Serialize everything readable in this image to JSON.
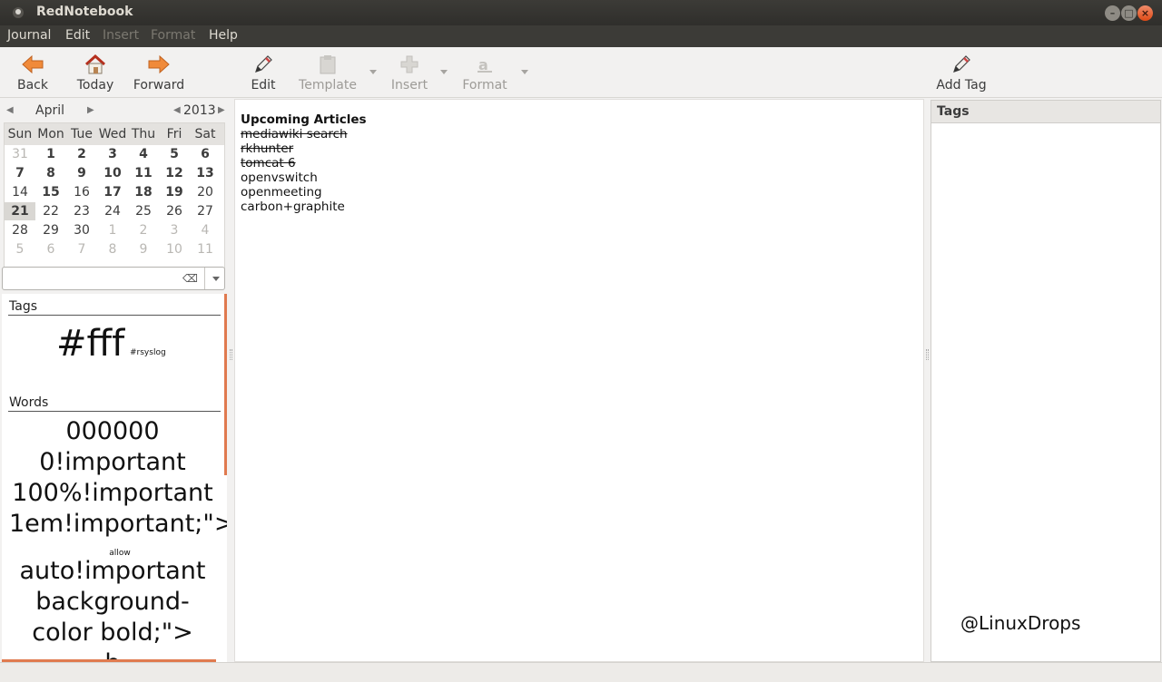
{
  "window": {
    "title": "RedNotebook"
  },
  "menu": [
    "Journal",
    "Edit",
    "Insert",
    "Format",
    "Help"
  ],
  "menu_disabled": [
    false,
    false,
    true,
    true,
    false
  ],
  "toolbar": {
    "back": "Back",
    "today": "Today",
    "forward": "Forward",
    "edit": "Edit",
    "template": "Template",
    "insert": "Insert",
    "format": "Format",
    "add_tag": "Add Tag"
  },
  "calendar": {
    "month": "April",
    "year": "2013",
    "weekdays": [
      "Sun",
      "Mon",
      "Tue",
      "Wed",
      "Thu",
      "Fri",
      "Sat"
    ],
    "weeks": [
      [
        {
          "d": "31",
          "s": "dim"
        },
        {
          "d": "1",
          "s": "b"
        },
        {
          "d": "2",
          "s": "b"
        },
        {
          "d": "3",
          "s": "b"
        },
        {
          "d": "4",
          "s": "b"
        },
        {
          "d": "5",
          "s": "b"
        },
        {
          "d": "6",
          "s": "b"
        }
      ],
      [
        {
          "d": "7",
          "s": "b"
        },
        {
          "d": "8",
          "s": "b"
        },
        {
          "d": "9",
          "s": "b"
        },
        {
          "d": "10",
          "s": "b"
        },
        {
          "d": "11",
          "s": "b"
        },
        {
          "d": "12",
          "s": "b"
        },
        {
          "d": "13",
          "s": "b"
        }
      ],
      [
        {
          "d": "14",
          "s": ""
        },
        {
          "d": "15",
          "s": "b"
        },
        {
          "d": "16",
          "s": ""
        },
        {
          "d": "17",
          "s": "b"
        },
        {
          "d": "18",
          "s": "b"
        },
        {
          "d": "19",
          "s": "b"
        },
        {
          "d": "20",
          "s": ""
        }
      ],
      [
        {
          "d": "21",
          "s": "b today"
        },
        {
          "d": "22",
          "s": ""
        },
        {
          "d": "23",
          "s": ""
        },
        {
          "d": "24",
          "s": ""
        },
        {
          "d": "25",
          "s": ""
        },
        {
          "d": "26",
          "s": ""
        },
        {
          "d": "27",
          "s": ""
        }
      ],
      [
        {
          "d": "28",
          "s": ""
        },
        {
          "d": "29",
          "s": ""
        },
        {
          "d": "30",
          "s": ""
        },
        {
          "d": "1",
          "s": "dim"
        },
        {
          "d": "2",
          "s": "dim"
        },
        {
          "d": "3",
          "s": "dim"
        },
        {
          "d": "4",
          "s": "dim"
        }
      ],
      [
        {
          "d": "5",
          "s": "dim"
        },
        {
          "d": "6",
          "s": "dim"
        },
        {
          "d": "7",
          "s": "dim"
        },
        {
          "d": "8",
          "s": "dim"
        },
        {
          "d": "9",
          "s": "dim"
        },
        {
          "d": "10",
          "s": "dim"
        },
        {
          "d": "11",
          "s": "dim"
        }
      ]
    ]
  },
  "search": {
    "value": ""
  },
  "cloud": {
    "tags_title": "Tags",
    "tag_big": "#fff",
    "tag_small": "#rsyslog",
    "words_title": "Words",
    "words": [
      "000000",
      "0!important",
      "100%!important",
      "1em!important;\">",
      "allow",
      "auto!important",
      "background-",
      "color bold;\">",
      "b"
    ]
  },
  "editor": {
    "heading": "Upcoming Articles",
    "done": [
      "mediawiki search",
      "rkhunter",
      "tomcat 6"
    ],
    "todo": [
      "openvswitch",
      "openmeeting",
      "carbon+graphite"
    ]
  },
  "tags_panel": {
    "title": "Tags"
  },
  "watermark": "@LinuxDrops",
  "colors": {
    "accent": "#e07a4f",
    "titlebar": "#3c3b37",
    "close": "#df4a16"
  }
}
